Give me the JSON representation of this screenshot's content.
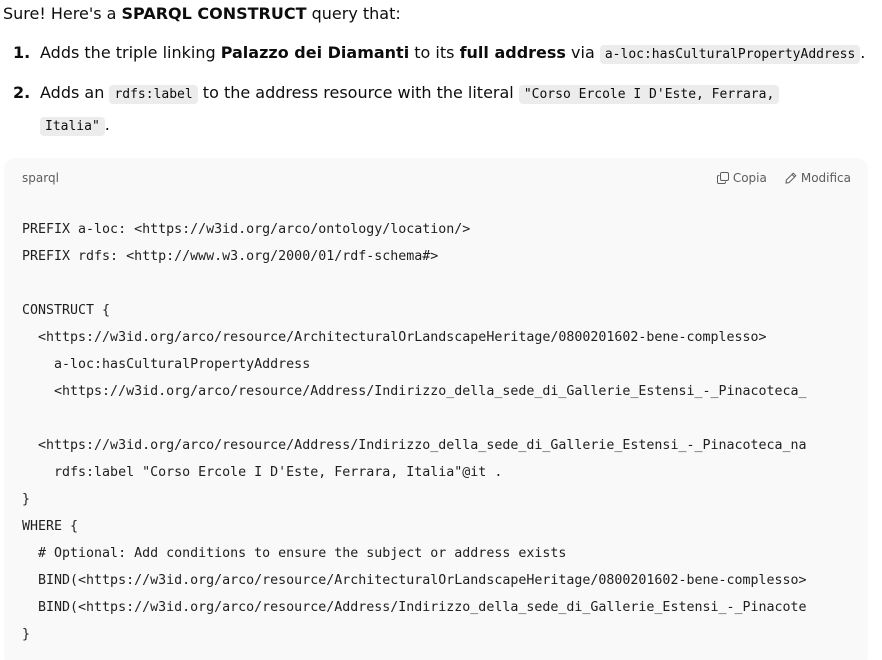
{
  "intro": {
    "prefix": "Sure! Here's a ",
    "bold": "SPARQL CONSTRUCT",
    "suffix": " query that:"
  },
  "list": {
    "item1": {
      "number": "1.",
      "t1": "Adds the triple linking ",
      "b1": "Palazzo dei Diamanti",
      "t2": " to its ",
      "b2": "full address",
      "t3": " via ",
      "code": "a-loc:hasCulturalPropertyAddress",
      "t4": "."
    },
    "item2": {
      "number": "2.",
      "t1": "Adds an ",
      "code1": "rdfs:label",
      "t2": " to the address resource with the literal ",
      "code2a": "\"Corso Ercole I D'Este, Ferrara,",
      "code2b": "Italia\"",
      "t3": "."
    }
  },
  "codeblock": {
    "language": "sparql",
    "copy_label": "Copia",
    "edit_label": "Modifica",
    "lines": [
      "PREFIX a-loc: <https://w3id.org/arco/ontology/location/>",
      "PREFIX rdfs: <http://www.w3.org/2000/01/rdf-schema#>",
      "",
      "CONSTRUCT {",
      "  <https://w3id.org/arco/resource/ArchitecturalOrLandscapeHeritage/0800201602-bene-complesso>",
      "    a-loc:hasCulturalPropertyAddress",
      "    <https://w3id.org/arco/resource/Address/Indirizzo_della_sede_di_Gallerie_Estensi_-_Pinacoteca_",
      "",
      "  <https://w3id.org/arco/resource/Address/Indirizzo_della_sede_di_Gallerie_Estensi_-_Pinacoteca_na",
      "    rdfs:label \"Corso Ercole I D'Este, Ferrara, Italia\"@it .",
      "}",
      "WHERE {",
      "  # Optional: Add conditions to ensure the subject or address exists",
      "  BIND(<https://w3id.org/arco/resource/ArchitecturalOrLandscapeHeritage/0800201602-bene-complesso>",
      "  BIND(<https://w3id.org/arco/resource/Address/Indirizzo_della_sede_di_Gallerie_Estensi_-_Pinacote",
      "}"
    ]
  },
  "icons": {
    "copy": "copy-icon",
    "edit": "pencil-icon"
  }
}
